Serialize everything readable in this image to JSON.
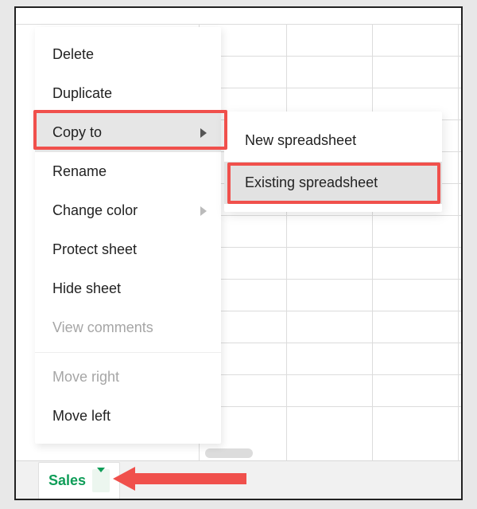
{
  "menu": {
    "delete_label": "Delete",
    "duplicate_label": "Duplicate",
    "copyto_label": "Copy to",
    "rename_label": "Rename",
    "changecolor_label": "Change color",
    "protectsheet_label": "Protect sheet",
    "hidesheet_label": "Hide sheet",
    "viewcomments_label": "View comments",
    "moveright_label": "Move right",
    "moveleft_label": "Move left"
  },
  "submenu": {
    "newspreadsheet_label": "New spreadsheet",
    "existingspreadsheet_label": "Existing spreadsheet"
  },
  "sheet": {
    "tab_name": "Sales"
  }
}
